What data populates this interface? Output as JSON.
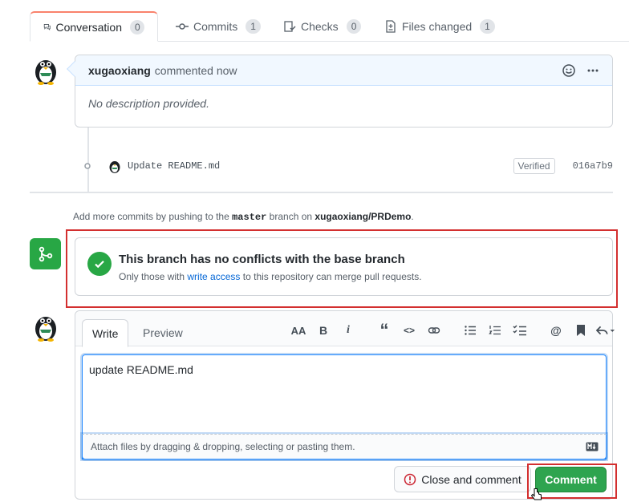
{
  "tabs": [
    {
      "label": "Conversation",
      "count": "0",
      "icon": "conversation-icon"
    },
    {
      "label": "Commits",
      "count": "1",
      "icon": "commit-icon"
    },
    {
      "label": "Checks",
      "count": "0",
      "icon": "checklist-icon"
    },
    {
      "label": "Files changed",
      "count": "1",
      "icon": "file-diff-icon"
    }
  ],
  "comment": {
    "author": "xugaoxiang",
    "time": "commented now",
    "body": "No description provided."
  },
  "commit": {
    "message": "Update README.md",
    "badge": "Verified",
    "sha": "016a7b9"
  },
  "note": {
    "prefix": "Add more commits by pushing to the",
    "branch": "master",
    "mid": "branch on",
    "repo": "xugaoxiang/PRDemo",
    "suffix": "."
  },
  "merge": {
    "title": "This branch has no conflicts with the base branch",
    "sub_prefix": "Only those with",
    "sub_link": "write access",
    "sub_suffix": "to this repository can merge pull requests."
  },
  "editor": {
    "tab_write": "Write",
    "tab_preview": "Preview",
    "text": "update README.md",
    "attach": "Attach files by dragging & dropping, selecting or pasting them.",
    "toolbar": {
      "heading": "AA",
      "bold": "B",
      "italic": "i",
      "quote": "“",
      "code": "<>",
      "link": "link-icon",
      "ul": "unordered-list-icon",
      "ol": "ordered-list-icon",
      "tasks": "task-list-icon",
      "mention": "@",
      "ref": "bookmark-icon",
      "reply": "reply-icon"
    }
  },
  "buttons": {
    "close_comment": "Close and comment",
    "comment": "Comment"
  },
  "colors": {
    "success": "#28a745",
    "link": "#0366d6",
    "highlight": "#d32f2f"
  }
}
